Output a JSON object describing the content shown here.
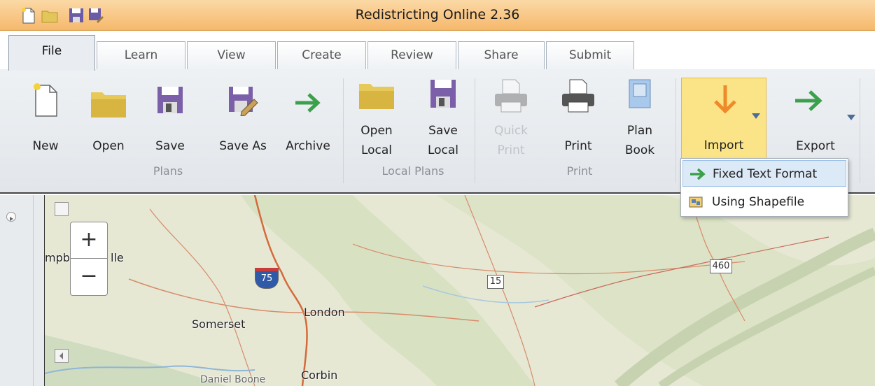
{
  "window": {
    "title": "Redistricting Online 2.36"
  },
  "quick_access": [
    "new-icon",
    "open-icon",
    "save-icon",
    "save-as-icon"
  ],
  "tabs": [
    {
      "label": "File",
      "active": true
    },
    {
      "label": "Learn"
    },
    {
      "label": "View"
    },
    {
      "label": "Create"
    },
    {
      "label": "Review"
    },
    {
      "label": "Share"
    },
    {
      "label": "Submit"
    }
  ],
  "ribbon": {
    "buttons": {
      "new": "New",
      "open": "Open",
      "save": "Save",
      "save_as": "Save As",
      "archive": "Archive",
      "open_local_1": "Open",
      "open_local_2": "Local",
      "save_local_1": "Save",
      "save_local_2": "Local",
      "quick_print_1": "Quick",
      "quick_print_2": "Print",
      "print": "Print",
      "plan_book_1": "Plan",
      "plan_book_2": "Book",
      "import": "Import",
      "export": "Export"
    },
    "groups": {
      "plans": "Plans",
      "local_plans": "Local Plans",
      "print": "Print"
    }
  },
  "import_menu": {
    "items": [
      {
        "label": "Fixed Text Format",
        "icon": "green-arrow-icon",
        "highlighted": true
      },
      {
        "label": "Using Shapefile",
        "icon": "shapefile-icon"
      }
    ]
  },
  "map": {
    "labels": {
      "campbellsville_left": "mpb",
      "campbellsville_right": "lle",
      "somerset": "Somerset",
      "london": "London",
      "corbin": "Corbin",
      "daniel_boone": "Daniel Boone"
    },
    "shields": {
      "i75": "75",
      "us15": "15",
      "us460": "460"
    },
    "zoom_in": "+",
    "zoom_out": "−"
  },
  "colors": {
    "titlebar": "#f6b86c",
    "import_highlight": "#fbe487",
    "arrow_green": "#3aa04a",
    "arrow_orange": "#ee8a2a",
    "save_purple": "#7b5fa8"
  }
}
